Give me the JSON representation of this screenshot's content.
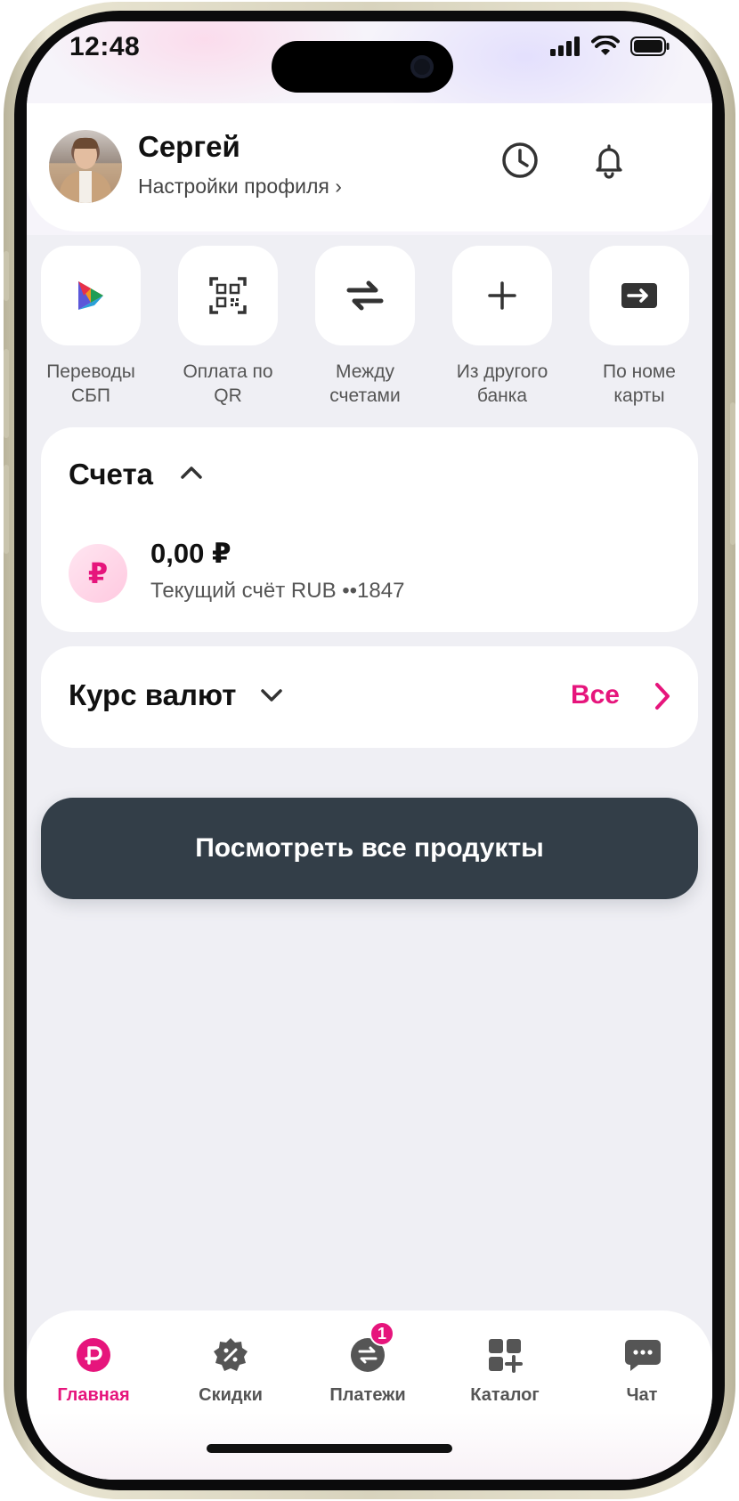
{
  "status": {
    "time": "12:48"
  },
  "header": {
    "user_name": "Сергей",
    "profile_link": "Настройки профиля ›"
  },
  "quick_actions": [
    {
      "label": "Переводы\nСБП",
      "icon": "sbp-icon"
    },
    {
      "label": "Оплата по\nQR",
      "icon": "qr-icon"
    },
    {
      "label": "Между\nсчетами",
      "icon": "transfer-arrows-icon"
    },
    {
      "label": "Из другого\nбанка",
      "icon": "plus-icon"
    },
    {
      "label": "По номе\nкарты",
      "icon": "card-arrow-icon"
    }
  ],
  "accounts": {
    "title": "Счета",
    "items": [
      {
        "currency_symbol": "₽",
        "balance": "0,00 ₽",
        "subtitle": "Текущий счёт RUB ••1847"
      }
    ]
  },
  "fx": {
    "title": "Курс валют",
    "all_label": "Все"
  },
  "products_button": "Посмотреть все продукты",
  "tabs": [
    {
      "label": "Главная",
      "icon": "home-icon",
      "active": true
    },
    {
      "label": "Скидки",
      "icon": "discount-icon"
    },
    {
      "label": "Платежи",
      "icon": "payments-icon",
      "badge": "1"
    },
    {
      "label": "Каталог",
      "icon": "catalog-icon"
    },
    {
      "label": "Чат",
      "icon": "chat-icon"
    }
  ],
  "colors": {
    "accent": "#e6157c",
    "dark_button": "#333e48",
    "background": "#efeff4"
  }
}
